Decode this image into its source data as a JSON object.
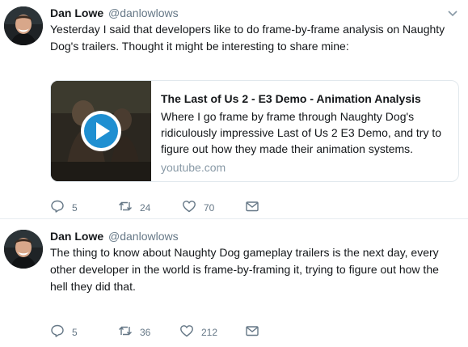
{
  "tweets": [
    {
      "author": {
        "name": "Dan Lowe",
        "handle": "@danlowlows"
      },
      "text": "Yesterday I said that developers like to do frame-by-frame analysis on Naughty Dog's trailers. Thought it might be interesting to share mine:",
      "card": {
        "title": "The Last of Us 2 - E3 Demo - Animation Analysis",
        "description": "Where I go frame by frame through Naughty Dog's ridiculously impressive Last of Us 2 E3 Demo, and try to figure out how they made their animation systems.",
        "domain": "youtube.com"
      },
      "stats": {
        "replies": "5",
        "retweets": "24",
        "likes": "70"
      }
    },
    {
      "author": {
        "name": "Dan Lowe",
        "handle": "@danlowlows"
      },
      "text": "The thing to know about Naughty Dog gameplay trailers is the next day, every other developer in the world is frame-by-framing it, trying to figure out how the hell they did that.",
      "stats": {
        "replies": "5",
        "retweets": "36",
        "likes": "212"
      }
    }
  ],
  "colors": {
    "icon": "#657786",
    "play_button": "#1f8fd1",
    "divider": "#e6ecf0"
  },
  "icons": [
    "caret-down-icon",
    "reply-icon",
    "retweet-icon",
    "like-icon",
    "direct-message-icon",
    "play-icon"
  ]
}
